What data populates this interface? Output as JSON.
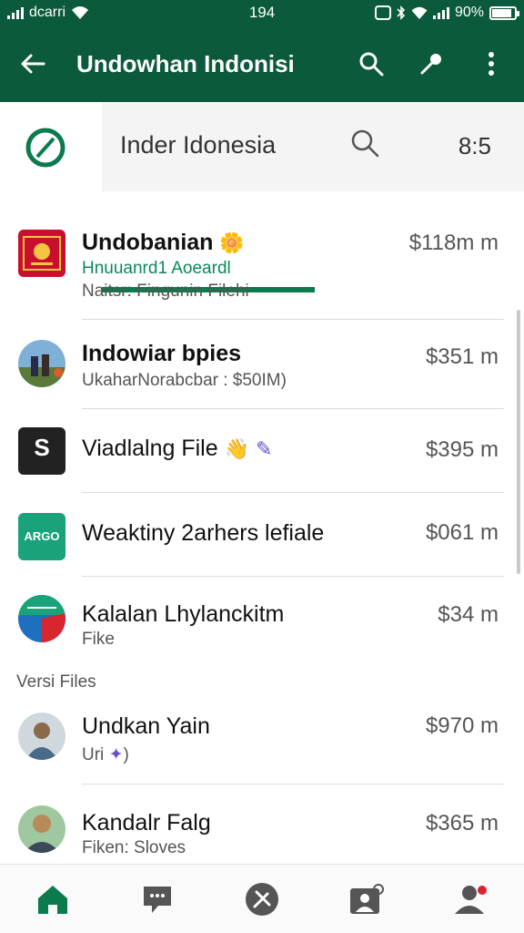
{
  "status_bar": {
    "carrier": "dcarri",
    "time": "194",
    "battery": "90%"
  },
  "app_bar": {
    "title": "Undowhan Indonisi"
  },
  "search": {
    "query": "Inder Idonesia",
    "count": "8:5"
  },
  "items": [
    {
      "title": "Undobanian",
      "sub1": "Hnuuanrd1 Aoeardl",
      "sub2": "Naitsr: Fingunin Filehi",
      "price": "$118m m"
    },
    {
      "title": "Indowiar bpies",
      "sub2": "UkaharNorabcbar : $50IM)",
      "price": "$351 m"
    },
    {
      "title": "Viadlalng File",
      "price": "$395 m"
    },
    {
      "title": "Weaktiny 2arhers lefiale",
      "price": "$061 m"
    },
    {
      "title": "Kalalan Lhylanckitm",
      "sub2": "Fike",
      "price": "$34 m"
    },
    {
      "title": "Undkan Yain",
      "sub2": "Uri",
      "price": "$970 m"
    },
    {
      "title": "Kandalr Falg",
      "sub2": "Fiken: Sloves",
      "price": "$365 m"
    }
  ],
  "section_label": "Versi Files",
  "thumb_labels": {
    "item4": "ARGO",
    "item3": "S"
  },
  "colors": {
    "primary": "#0b5a3c",
    "accent": "#0b7a4c",
    "nav_icon": "#555555"
  }
}
